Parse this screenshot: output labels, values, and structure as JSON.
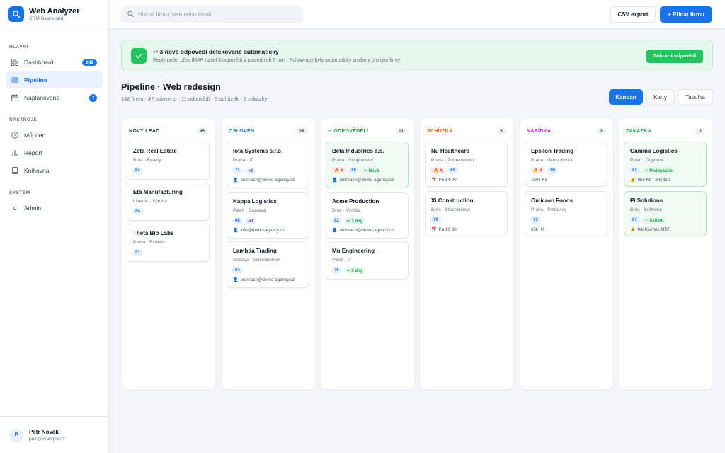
{
  "app": {
    "title": "Web Analyzer",
    "subtitle": "CRM Dashboard",
    "logo_icon": "search-icon"
  },
  "sidebar": {
    "sections": [
      {
        "label": "HLAVNÍ"
      },
      {
        "label": "NÁSTROJE"
      },
      {
        "label": "SYSTÉM"
      }
    ],
    "items": [
      {
        "label": "Dashboard",
        "icon": "grid-icon",
        "badge": "142"
      },
      {
        "label": "Pipeline",
        "icon": "list-icon",
        "active": true
      },
      {
        "label": "Naplánované",
        "icon": "calendar-icon",
        "badge": "7"
      },
      {
        "label": "Můj den",
        "icon": "clock-icon"
      },
      {
        "label": "Report",
        "icon": "bar-chart-icon"
      },
      {
        "label": "Knihovna",
        "icon": "book-icon"
      },
      {
        "label": "Admin",
        "icon": "dot-icon"
      }
    ],
    "user": {
      "initial": "P",
      "name": "Petr Novák",
      "email": "petr@example.cz"
    }
  },
  "topbar": {
    "search_placeholder": "Hledat firmu, web nebo email...",
    "csv_label": "CSV export",
    "add_label": "+ Přidat firmu"
  },
  "alert": {
    "title": "↩ 3 nové odpovědi detekované automaticky",
    "text": "Reply poller přes IMAP našel 3 odpovědi v posledních 5 min · Follow-upy byly automaticky zrušeny pro tyto firmy",
    "button": "Zobrazit odpovědi"
  },
  "header": {
    "title": "Pipeline · Web redesign",
    "subtitle": "142 firem · 47 osloveno · 11 odpovědí · 5 schůzek · 2 zakázky",
    "views": [
      "Kanban",
      "Karty",
      "Tabulka"
    ],
    "active_view": "Kanban"
  },
  "colors": {
    "accent": "#1a73e8",
    "new_lead": "#374151",
    "osloven": "#1a73e8",
    "odpovedeli": "#16a34a",
    "schuzka": "#ea580c",
    "nabidka": "#c026d3",
    "zakazka": "#16a34a"
  },
  "columns": [
    {
      "title": "NOVÝ LEAD",
      "count": "95",
      "cards": [
        {
          "name": "Zeta Real Estate",
          "meta": "Brno · Reality",
          "score": "64"
        },
        {
          "name": "Eta Manufacturing",
          "meta": "Liberec · Výroba",
          "score": "58"
        },
        {
          "name": "Theta Bio Labs",
          "meta": "Praha · Biotech",
          "score": "51"
        }
      ]
    },
    {
      "title": "OSLOVEN",
      "count": "28",
      "cards": [
        {
          "name": "Iota Systems s.r.o.",
          "meta": "Praha · IT",
          "score": "71",
          "tag2": "➜3",
          "foot": "outreach@demo-agency.cz"
        },
        {
          "name": "Kappa Logistics",
          "meta": "Plzeň · Doprava",
          "score": "68",
          "tag2": "➜1",
          "foot": "info@demo-agency.cz"
        },
        {
          "name": "Lambda Trading",
          "meta": "Ostrava · Velkoobchod",
          "score": "64",
          "foot": "outreach@demo-agency.cz"
        }
      ]
    },
    {
      "title": "↩ ODPOVĚDĚLI",
      "count": "11",
      "cards": [
        {
          "name": "Beta Industries a.s.",
          "meta": "Praha · Strojírenství",
          "hot": "🔥 A",
          "score": "88",
          "tag2": "↩ Nová",
          "foot": "outreach@demo-agency.cz"
        },
        {
          "name": "Acme Production",
          "meta": "Brno · Výroba",
          "score": "92",
          "tag2": "↩ 2 dny",
          "foot": "outreach@demo-agency.cz"
        },
        {
          "name": "Mu Engineering",
          "meta": "Plzeň · IT",
          "score": "76",
          "tag2": "↩ 3 dny"
        }
      ]
    },
    {
      "title": "SCHŮZKA",
      "count": "5",
      "cards": [
        {
          "name": "Nu Healthcare",
          "meta": "Praha · Zdravotnictví",
          "hot": "🔥 A",
          "score": "85",
          "foot": "Po 14:00"
        },
        {
          "name": "Xi Construction",
          "meta": "Brno · Stavebnictví",
          "score": "79",
          "foot": "Pá 10:30"
        }
      ]
    },
    {
      "title": "NABÍDKA",
      "count": "3",
      "cards": [
        {
          "name": "Epsilon Trading",
          "meta": "Praha · Velkoobchod",
          "hot": "🔥 A",
          "score": "90",
          "foot": "150k Kč"
        },
        {
          "name": "Omicron Foods",
          "meta": "Praha · Potraviny",
          "score": "73",
          "foot": "65k Kč"
        }
      ]
    },
    {
      "title": "ZAKÁZKA",
      "count": "2",
      "cards": [
        {
          "name": "Gamma Logistics",
          "meta": "Plzeň · Doprava",
          "score": "82",
          "tag2": "✓ Podepsáno",
          "foot": "95k Kč · 8 týdnů"
        },
        {
          "name": "Pi Solutions",
          "meta": "Brno · Software",
          "score": "87",
          "tag2": "✓ Aktivní",
          "foot": "8/k Kč/měs MRR"
        }
      ]
    }
  ]
}
